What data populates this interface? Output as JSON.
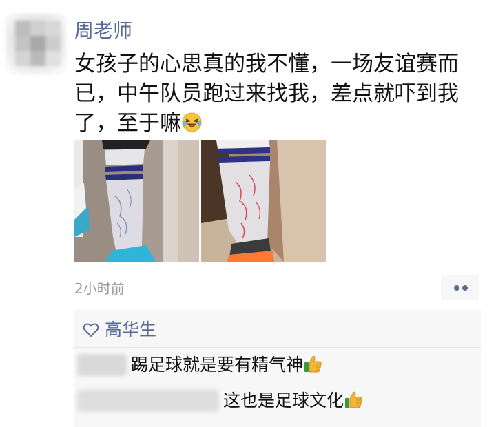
{
  "post": {
    "author": "周老师",
    "content_lines": [
      "女孩子的心思真的我不懂，一场友谊赛而",
      "已，中午队员跑过来找我，差点就吓到我",
      "了，至于嘛"
    ],
    "content_emoji": "laughing-crying-emoji",
    "images": [
      "photo-sock-1",
      "photo-sock-2"
    ],
    "timestamp": "2小时前",
    "more_icon": "two-dots-icon"
  },
  "likes": {
    "icon": "heart-outline-icon",
    "names": "高华生"
  },
  "comments": [
    {
      "text": "踢足球就是要有精气神",
      "emoji": "thumbs-up-emoji"
    },
    {
      "text": "这也是足球文化",
      "emoji": "thumbs-up-emoji"
    }
  ],
  "colors": {
    "name_blue": "#576b95",
    "text": "#111111",
    "timestamp_gray": "#9b9b9b",
    "comment_bg": "#f7f7f7"
  }
}
